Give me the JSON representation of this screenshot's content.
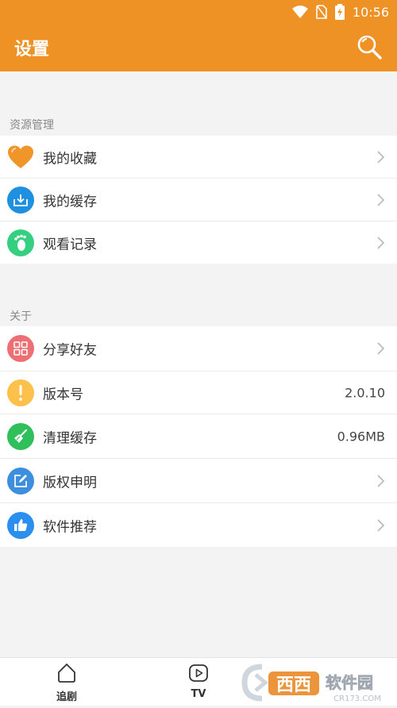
{
  "status": {
    "time": "10:56"
  },
  "header": {
    "title": "设置"
  },
  "sections": [
    {
      "title": "资源管理",
      "items": [
        {
          "label": "我的收藏",
          "icon": "heart-icon",
          "color": "#f0952a"
        },
        {
          "label": "我的缓存",
          "icon": "download-icon",
          "color": "#1f8fe0"
        },
        {
          "label": "观看记录",
          "icon": "footprint-icon",
          "color": "#35d07f"
        }
      ]
    },
    {
      "title": "关于",
      "items": [
        {
          "label": "分享好友",
          "icon": "grid-icon",
          "color": "#ee6f73"
        },
        {
          "label": "版本号",
          "value": "2.0.10",
          "icon": "exclamation-icon",
          "color": "#fbc14a"
        },
        {
          "label": "清理缓存",
          "value": "0.96MB",
          "icon": "broom-icon",
          "color": "#2fbf5b"
        },
        {
          "label": "版权申明",
          "icon": "edit-icon",
          "color": "#3d8fde"
        },
        {
          "label": "软件推荐",
          "icon": "thumbs-up-icon",
          "color": "#2b8fef"
        }
      ]
    }
  ],
  "tabs": [
    {
      "label": "追剧",
      "icon": "home-icon"
    },
    {
      "label": "TV",
      "icon": "play-icon"
    }
  ],
  "watermark": {
    "brand": "西西",
    "text": "软件园",
    "site": "CR173.COM"
  }
}
